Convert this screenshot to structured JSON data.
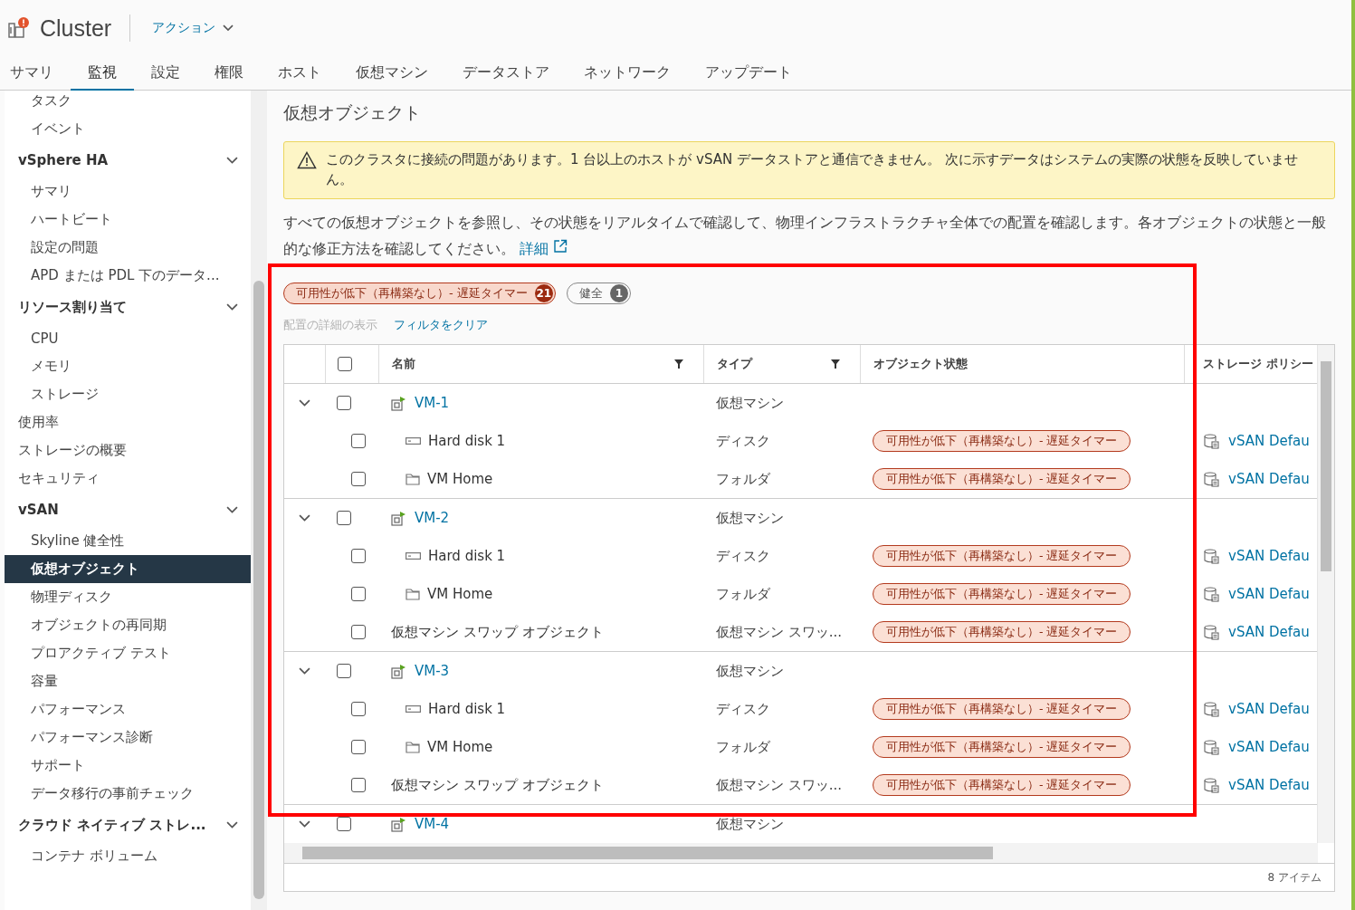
{
  "header": {
    "title": "Cluster",
    "actions": "アクション"
  },
  "tabs": [
    {
      "label": "サマリ",
      "selected": false
    },
    {
      "label": "監視",
      "selected": true
    },
    {
      "label": "設定",
      "selected": false
    },
    {
      "label": "権限",
      "selected": false
    },
    {
      "label": "ホスト",
      "selected": false
    },
    {
      "label": "仮想マシン",
      "selected": false
    },
    {
      "label": "データストア",
      "selected": false
    },
    {
      "label": "ネットワーク",
      "selected": false
    },
    {
      "label": "アップデート",
      "selected": false
    }
  ],
  "sidebar": {
    "items": [
      {
        "children": [
          {
            "label": "タスク",
            "selected": false
          },
          {
            "label": "イベント",
            "selected": false
          }
        ]
      },
      {
        "label": "vSphere HA",
        "expanded": true,
        "children": [
          {
            "label": "サマリ",
            "selected": false
          },
          {
            "label": "ハートビート",
            "selected": false
          },
          {
            "label": "設定の問題",
            "selected": false
          },
          {
            "label": "APD または PDL 下のデータ...",
            "selected": false
          }
        ]
      },
      {
        "label": "リソース割り当て",
        "expanded": true,
        "children": [
          {
            "label": "CPU",
            "selected": false
          },
          {
            "label": "メモリ",
            "selected": false
          },
          {
            "label": "ストレージ",
            "selected": false
          }
        ]
      },
      {
        "label": "使用率",
        "selected": false
      },
      {
        "label": "ストレージの概要",
        "selected": false
      },
      {
        "label": "セキュリティ",
        "selected": false
      },
      {
        "label": "vSAN",
        "expanded": true,
        "children": [
          {
            "label": "Skyline 健全性",
            "selected": false
          },
          {
            "label": "仮想オブジェクト",
            "selected": true
          },
          {
            "label": "物理ディスク",
            "selected": false
          },
          {
            "label": "オブジェクトの再同期",
            "selected": false
          },
          {
            "label": "プロアクティブ テスト",
            "selected": false
          },
          {
            "label": "容量",
            "selected": false
          },
          {
            "label": "パフォーマンス",
            "selected": false
          },
          {
            "label": "パフォーマンス診断",
            "selected": false
          },
          {
            "label": "サポート",
            "selected": false
          },
          {
            "label": "データ移行の事前チェック",
            "selected": false
          }
        ]
      },
      {
        "label": "クラウド ネイティブ ストレ...",
        "expanded": true,
        "children": [
          {
            "label": "コンテナ ボリューム",
            "selected": false
          }
        ]
      }
    ]
  },
  "main": {
    "title": "仮想オブジェクト",
    "warning": "このクラスタに接続の問題があります。1 台以上のホストが vSAN データストアと通信できません。 次に示すデータはシステムの実際の状態を反映していません。",
    "description": "すべての仮想オブジェクトを参照し、その状態をリアルタイムで確認して、物理インフラストラクチャ全体での配置を確認します。各オブジェクトの状態と一般的な修正方法を確認してください。",
    "details_link": "詳細",
    "filters": [
      {
        "label": "可用性が低下（再構築なし）- 遅延タイマー",
        "count": "21",
        "kind": "danger"
      },
      {
        "label": "健全",
        "count": "1",
        "kind": "neutral"
      }
    ],
    "placement_link": "配置の詳細の表示",
    "placement_disabled": true,
    "clear_filter": "フィルタをクリア",
    "table": {
      "header_checked": false,
      "columns": [
        "名前",
        "タイプ",
        "オブジェクト状態",
        "ストレージ ポリシー"
      ],
      "rows": [
        {
          "kind": "vm",
          "name": "VM-1",
          "type": "仮想マシン",
          "expanded": true,
          "checked": false
        },
        {
          "kind": "disk",
          "name": "Hard disk 1",
          "type": "ディスク",
          "status": "可用性が低下（再構築なし）- 遅延タイマー",
          "policy": "vSAN Defau",
          "checked": false
        },
        {
          "kind": "folder",
          "name": "VM Home",
          "type": "フォルダ",
          "status": "可用性が低下（再構築なし）- 遅延タイマー",
          "policy": "vSAN Defau",
          "checked": false
        },
        {
          "kind": "vm",
          "name": "VM-2",
          "type": "仮想マシン",
          "expanded": true,
          "checked": false
        },
        {
          "kind": "disk",
          "name": "Hard disk 1",
          "type": "ディスク",
          "status": "可用性が低下（再構築なし）- 遅延タイマー",
          "policy": "vSAN Defau",
          "checked": false
        },
        {
          "kind": "folder",
          "name": "VM Home",
          "type": "フォルダ",
          "status": "可用性が低下（再構築なし）- 遅延タイマー",
          "policy": "vSAN Defau",
          "checked": false
        },
        {
          "kind": "object",
          "name": "仮想マシン スワップ オブジェクト",
          "type": "仮想マシン スワッ...",
          "status": "可用性が低下（再構築なし）- 遅延タイマー",
          "policy": "vSAN Defau",
          "checked": false
        },
        {
          "kind": "vm",
          "name": "VM-3",
          "type": "仮想マシン",
          "expanded": true,
          "checked": false
        },
        {
          "kind": "disk",
          "name": "Hard disk 1",
          "type": "ディスク",
          "status": "可用性が低下（再構築なし）- 遅延タイマー",
          "policy": "vSAN Defau",
          "checked": false
        },
        {
          "kind": "folder",
          "name": "VM Home",
          "type": "フォルダ",
          "status": "可用性が低下（再構築なし）- 遅延タイマー",
          "policy": "vSAN Defau",
          "checked": false
        },
        {
          "kind": "object",
          "name": "仮想マシン スワップ オブジェクト",
          "type": "仮想マシン スワッ...",
          "status": "可用性が低下（再構築なし）- 遅延タイマー",
          "policy": "vSAN Defau",
          "checked": false
        },
        {
          "kind": "vm",
          "name": "VM-4",
          "type": "仮想マシン",
          "expanded": true,
          "checked": false
        }
      ],
      "footer": "8 アイテム"
    }
  }
}
